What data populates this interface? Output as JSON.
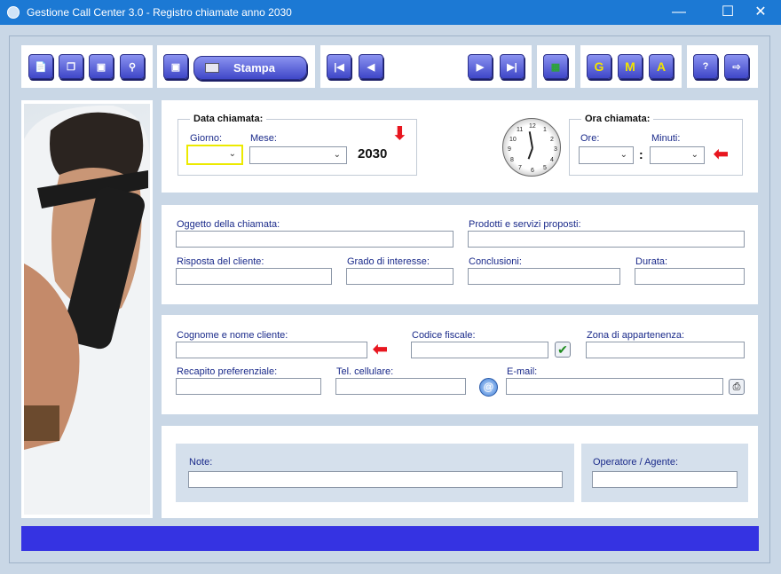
{
  "window": {
    "title": "Gestione Call Center 3.0 - Registro chiamate anno 2030"
  },
  "toolbar": {
    "stampa_label": "Stampa",
    "g_label": "G",
    "m_label": "M",
    "a_label": "A",
    "help_label": "?"
  },
  "data_chiamata": {
    "heading": "Data chiamata:",
    "giorno_label": "Giorno:",
    "mese_label": "Mese:",
    "year": "2030"
  },
  "ora_chiamata": {
    "heading": "Ora chiamata:",
    "ore_label": "Ore:",
    "minuti_label": "Minuti:",
    "separator": ":"
  },
  "clock": {
    "numbers": [
      "12",
      "1",
      "2",
      "3",
      "4",
      "5",
      "6",
      "7",
      "8",
      "9",
      "10",
      "11"
    ]
  },
  "chiamata": {
    "oggetto_label": "Oggetto della chiamata:",
    "prodotti_label": "Prodotti e servizi proposti:",
    "risposta_label": "Risposta del cliente:",
    "grado_label": "Grado di interesse:",
    "conclusioni_label": "Conclusioni:",
    "durata_label": "Durata:"
  },
  "cliente": {
    "nome_label": "Cognome e nome cliente:",
    "codice_label": "Codice fiscale:",
    "zona_label": "Zona di appartenenza:",
    "recapito_label": "Recapito preferenziale:",
    "cellulare_label": "Tel. cellulare:",
    "email_label": "E-mail:"
  },
  "note": {
    "note_label": "Note:",
    "operatore_label": "Operatore / Agente:"
  },
  "colors": {
    "titlebar": "#1c79d4",
    "accent": "#3533e2",
    "arrow": "#e8161f"
  }
}
